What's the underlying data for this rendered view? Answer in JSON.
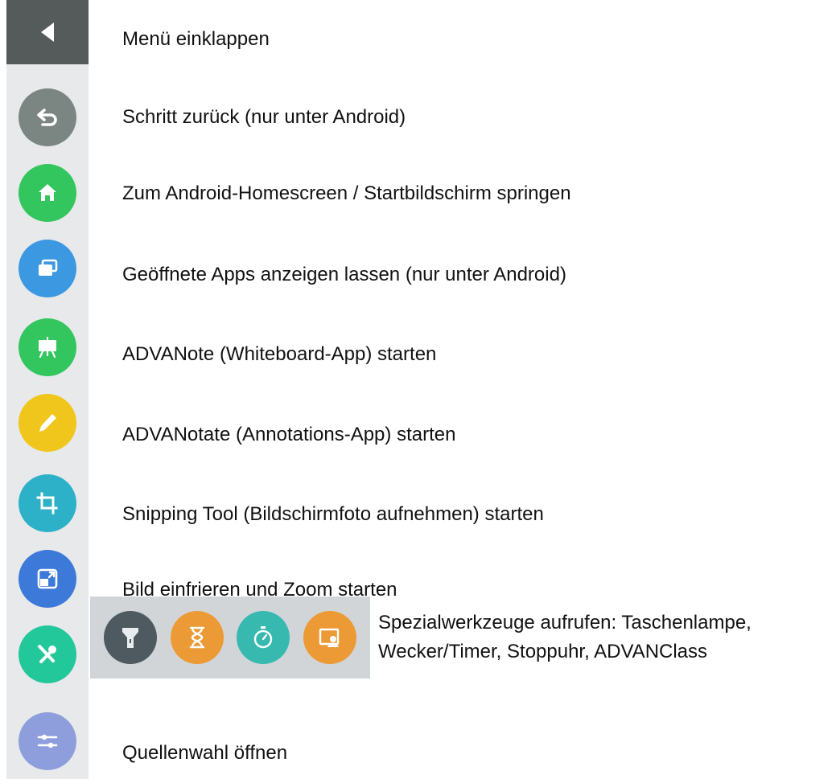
{
  "sidebar": {
    "collapse": {
      "icon": "triangle-left-icon",
      "label": "Menü einklappen"
    },
    "items": [
      {
        "icon": "back-arrow-icon",
        "color": "#7b8582",
        "label": "Schritt zurück (nur unter Android)"
      },
      {
        "icon": "home-icon",
        "color": "#33c55e",
        "label": "Zum Android-Homescreen / Startbildschirm springen"
      },
      {
        "icon": "recent-apps-icon",
        "color": "#3d98e2",
        "label": "Geöffnete Apps anzeigen lassen (nur unter Android)"
      },
      {
        "icon": "whiteboard-icon",
        "color": "#33c55e",
        "label": "ADVANote (Whiteboard-App) starten"
      },
      {
        "icon": "pencil-icon",
        "color": "#f0c61d",
        "label": "ADVANotate (Annotations-App) starten"
      },
      {
        "icon": "crop-icon",
        "color": "#2db1c8",
        "label": "Snipping Tool (Bildschirmfoto aufnehmen) starten"
      },
      {
        "icon": "freeze-zoom-icon",
        "color": "#3c79d8",
        "label": "Bild einfrieren und Zoom starten"
      },
      {
        "icon": "tools-icon",
        "color": "#22c79a",
        "label_lines": [
          "Spezialwerkzeuge aufrufen: Taschenlampe,",
          "Wecker/Timer, Stoppuhr, ADVANClass"
        ]
      },
      {
        "icon": "sliders-icon",
        "color": "#8e9edd",
        "label": "Quellenwahl öffnen"
      }
    ]
  },
  "special_tools": [
    {
      "icon": "flashlight-icon",
      "color": "#4e5a5f"
    },
    {
      "icon": "hourglass-icon",
      "color": "#ec9a36"
    },
    {
      "icon": "stopwatch-icon",
      "color": "#38b9b0"
    },
    {
      "icon": "class-icon",
      "color": "#ec9a36"
    }
  ]
}
